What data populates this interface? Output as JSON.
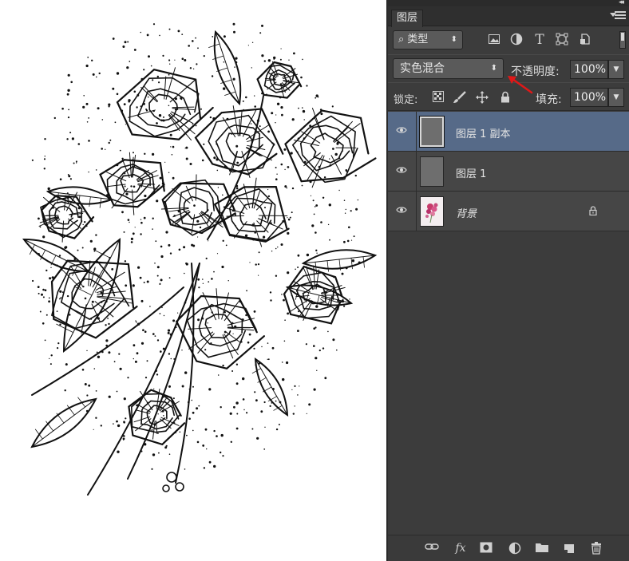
{
  "panel": {
    "collapse_glyph": "◂◂",
    "tab_label": "图层"
  },
  "filter": {
    "kind_label": "类型",
    "icons": [
      "image-filter-icon",
      "adjustment-filter-icon",
      "type-filter-icon",
      "shape-filter-icon",
      "smart-object-filter-icon"
    ]
  },
  "blend": {
    "mode": "实色混合",
    "opacity_label": "不透明度:",
    "opacity_value": "100%"
  },
  "lock": {
    "label": "锁定:",
    "fill_label": "填充:",
    "fill_value": "100%"
  },
  "layers": [
    {
      "name": "图层 1 副本",
      "selected": true,
      "visible": true,
      "locked": false
    },
    {
      "name": "图层 1",
      "selected": false,
      "visible": true,
      "locked": false
    },
    {
      "name": "背景",
      "selected": false,
      "visible": true,
      "locked": true
    }
  ],
  "bottom_icons": [
    "link-layers-icon",
    "fx-icon",
    "layer-mask-icon",
    "adjustment-layer-icon",
    "group-folder-icon",
    "new-layer-icon",
    "trash-icon"
  ],
  "bottom_fx_label": "fx",
  "colors": {
    "panel_bg": "#3c3c3c",
    "selected_row": "#566a88",
    "annotation_arrow": "#e01818"
  }
}
